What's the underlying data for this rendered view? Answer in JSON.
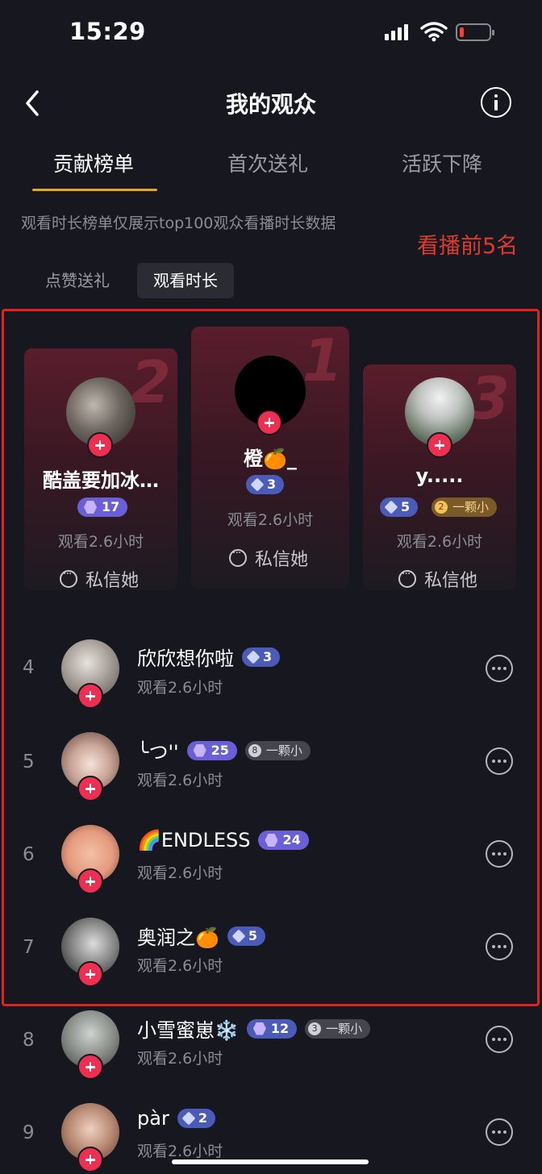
{
  "status_bar": {
    "time": "15:29"
  },
  "nav": {
    "title": "我的观众"
  },
  "tabs": [
    {
      "label": "贡献榜单",
      "active": true
    },
    {
      "label": "首次送礼",
      "active": false
    },
    {
      "label": "活跃下降",
      "active": false
    }
  ],
  "notice": "观看时长榜单仅展示top100观众看播时长数据",
  "annotation": "看播前5名",
  "segments": {
    "likes_gifts": "点赞送礼",
    "watch_time": "观看时长"
  },
  "podium": [
    {
      "rank": "2",
      "name": "酷盖要加冰…",
      "level": "17",
      "watch": "观看2.6小时",
      "dm": "私信她"
    },
    {
      "rank": "1",
      "name": "橙🍊_",
      "level": "3",
      "watch": "观看2.6小时",
      "dm": "私信她"
    },
    {
      "rank": "3",
      "name": "y.....",
      "level": "5",
      "fan_level": "2",
      "fan_label": "一颗小",
      "watch": "观看2.6小时",
      "dm": "私信他"
    }
  ],
  "list": [
    {
      "rank": "4",
      "name": "欣欣想你啦",
      "level": "3",
      "watch": "观看2.6小时"
    },
    {
      "rank": "5",
      "name": "╰つ''",
      "level": "25",
      "fan_level": "8",
      "fan_label": "一颗小",
      "watch": "观看2.6小时"
    },
    {
      "rank": "6",
      "name": "🌈ENDLESS",
      "level": "24",
      "watch": "观看2.6小时"
    },
    {
      "rank": "7",
      "name": "奥润之🍊",
      "level": "5",
      "watch": "观看2.6小时"
    },
    {
      "rank": "8",
      "name": "小雪蜜崽❄️",
      "level": "12",
      "fan_level": "3",
      "fan_label": "一颗小",
      "watch": "观看2.6小时"
    },
    {
      "rank": "9",
      "name": "pàr",
      "level": "2",
      "watch": "观看2.6小时"
    }
  ],
  "colors": {
    "accent_tab": "#e6a817",
    "plus": "#ee2f52",
    "annotation": "#e3221b"
  }
}
